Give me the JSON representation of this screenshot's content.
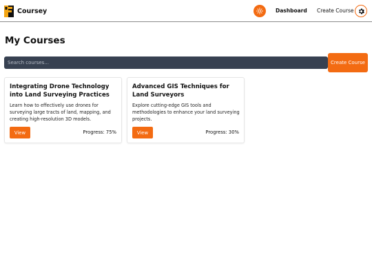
{
  "navbar": {
    "brand_name": "Coursey",
    "links": {
      "dashboard": "Dashboard",
      "create_course": "Create Course"
    },
    "icons": {
      "logo": "coursey-logo-icon",
      "theme": "sun-icon",
      "settings": "gear-icon"
    }
  },
  "main": {
    "title": "My Courses",
    "search": {
      "placeholder": "Search courses...",
      "value": ""
    },
    "create_button": "Create Course",
    "courses": [
      {
        "title": "Integrating Drone Technology into Land Surveying Practices",
        "description": "Learn how to effectively use drones for surveying large tracts of land, mapping, and creating high-resolution 3D models.",
        "view_label": "View",
        "progress": "Progress: 75%"
      },
      {
        "title": "Advanced GIS Techniques for Land Surveyors",
        "description": "Explore cutting-edge GIS tools and methodologies to enhance your land surveying projects.",
        "view_label": "View",
        "progress": "Progress: 30%"
      }
    ]
  },
  "colors": {
    "accent": "#f36b12",
    "search_bg": "#374151",
    "text": "#111111"
  }
}
